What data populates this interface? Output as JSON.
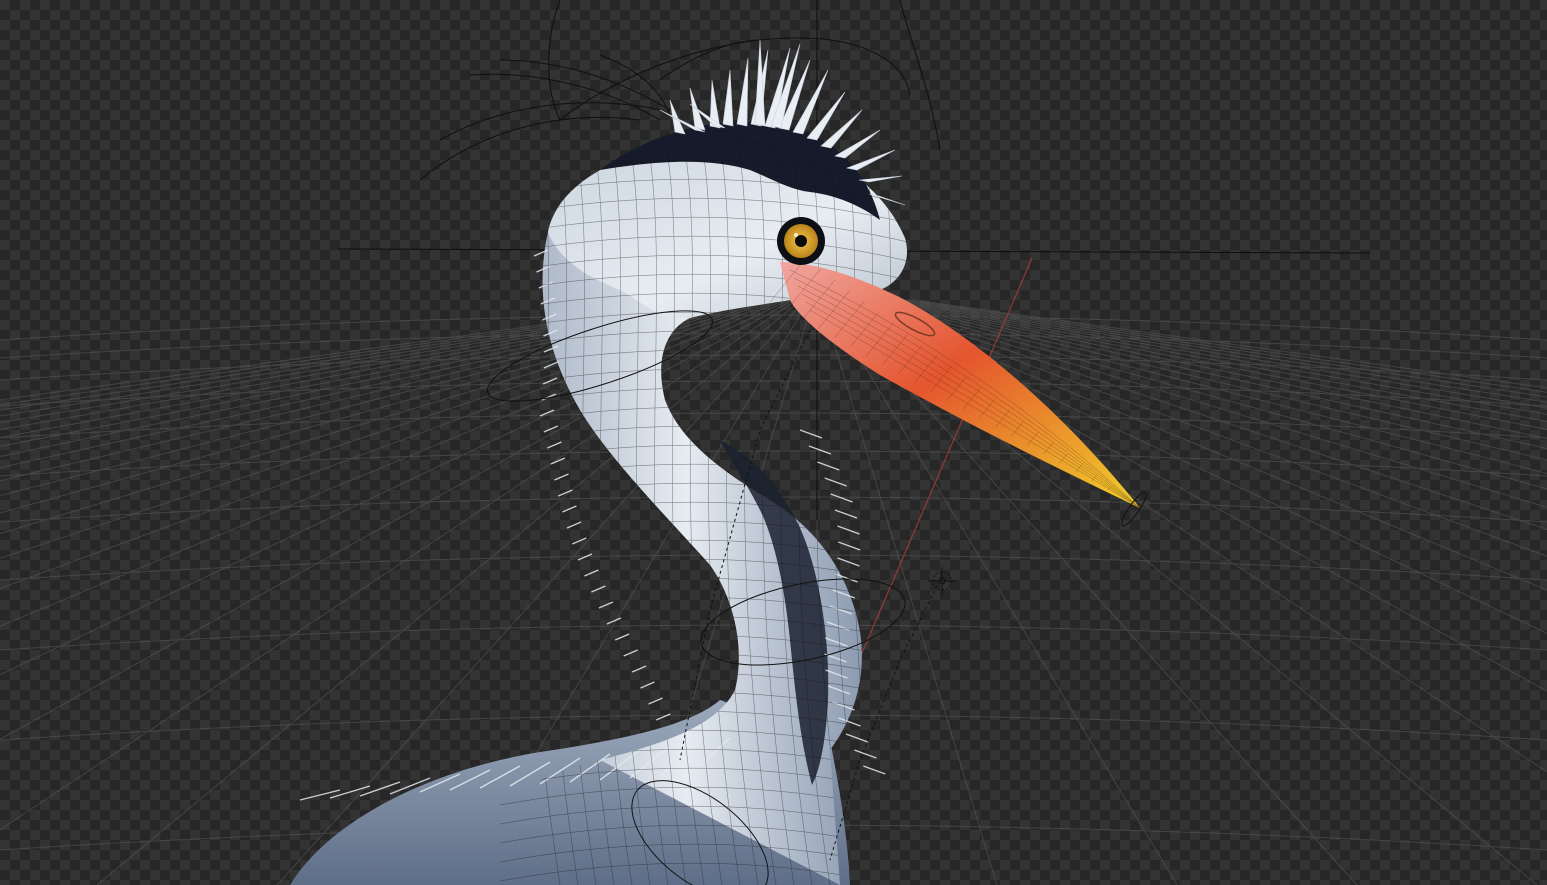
{
  "viewport": {
    "background": "#2a2a2a",
    "checker_light": "#333333",
    "checker_dark": "#272727",
    "grid_color": "#5a5a5a",
    "axis_x_color": "#b03a3a",
    "crosshair_color": "#0e0e0e",
    "wire_color": "#141414",
    "checker_icon": "checkerboard-icon"
  },
  "model": {
    "name": "heron",
    "body_color": "#7f8ea6",
    "body_light": "#dfe6ee",
    "body_dark": "#3b4760",
    "crest_color": "#151b2a",
    "stripe_color": "#1b2130",
    "eye_color": "#e0a92a",
    "pupil_color": "#0b0b0b",
    "beak_base": "#f0a6a0",
    "beak_mid": "#e4552e",
    "beak_tip": "#f1d12a"
  },
  "rig": {
    "controls": [
      "crest-arc-control",
      "neck-ring-upper",
      "neck-ring-lower",
      "chest-ring",
      "beak-tip-ring",
      "pole-target"
    ],
    "pole_icon": "crosshair-icon"
  }
}
